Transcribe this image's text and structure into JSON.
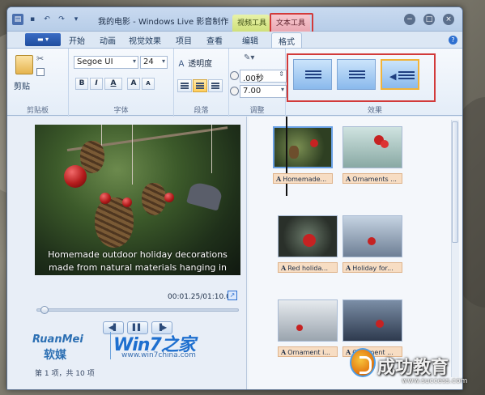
{
  "titlebar": {
    "title": "我的电影 - Windows Live 影音制作",
    "ctx_video_tools": "视频工具",
    "ctx_text_tools": "文本工具"
  },
  "tabs": {
    "file": "▬ ▾",
    "items": [
      "开始",
      "动画",
      "视觉效果",
      "项目",
      "查看",
      "编辑",
      "格式"
    ],
    "active": "格式"
  },
  "ribbon": {
    "clipboard": {
      "paste": "剪贴",
      "label": "剪贴板"
    },
    "font": {
      "family": "Segoe UI",
      "size": "24",
      "bold": "B",
      "italic": "I",
      "color": "A",
      "grow": "A",
      "shrink": "A",
      "label": "字体"
    },
    "paragraph": {
      "transparency": "透明度",
      "label": "段落"
    },
    "adjust": {
      "start_time": ".00秒",
      "duration": "7.00",
      "label": "调整"
    },
    "effects": {
      "label": "效果"
    }
  },
  "preview": {
    "caption_line1": "Homemade outdoor holiday decorations",
    "caption_line2": "made from natural materials hanging in",
    "timecode": "00:01.25/01:10.00",
    "status": "第 1 项，共 10 项",
    "progress_fraction": 0.02
  },
  "storyboard": {
    "clips": [
      {
        "label": "Homemade..."
      },
      {
        "label": "Ornaments ..."
      },
      {
        "label": "Red holida..."
      },
      {
        "label": "Holiday for..."
      },
      {
        "label": "Ornament i..."
      },
      {
        "label": "Ornament ..."
      }
    ]
  },
  "watermarks": {
    "ruanmei_en": "RuanMei",
    "ruanmei_cn": "软媒",
    "win7": "Win7之家",
    "win7_url": "www.win7china.com",
    "cgjy": "成功教育",
    "cgjy_url": "www.success.com"
  },
  "colors": {
    "accent": "#2c6fd0",
    "highlight_red": "#d23a3a",
    "ctx_video": "#cfe07a",
    "ctx_text": "#e9a7b1"
  }
}
